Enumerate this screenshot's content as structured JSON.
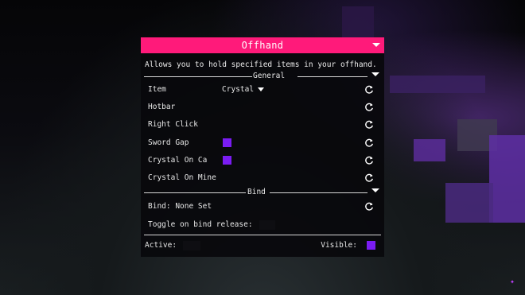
{
  "module": {
    "title": "Offhand",
    "description": "Allows you to hold specified items in your offhand."
  },
  "general": {
    "label": "General",
    "item": {
      "label": "Item",
      "value": "Crystal"
    },
    "hotbar": {
      "label": "Hotbar",
      "checked": false
    },
    "right_click": {
      "label": "Right Click",
      "checked": false
    },
    "sword_gap": {
      "label": "Sword Gap",
      "checked": true
    },
    "crystal_on_ca": {
      "label": "Crystal On Ca",
      "checked": true
    },
    "crystal_on_mine": {
      "label": "Crystal On Mine",
      "checked": false
    }
  },
  "bind": {
    "label": "Bind",
    "bind_text": "Bind: None Set",
    "toggle_label": "Toggle on bind release:",
    "toggle_checked": false
  },
  "footer": {
    "active_label": "Active:",
    "active_checked": false,
    "visible_label": "Visible:",
    "visible_checked": true
  },
  "colors": {
    "accent_header": "#ff1a7a",
    "checkbox": "#7a1cf2"
  },
  "icons": {
    "reset": "reset-icon",
    "collapse": "chevron-down-icon"
  }
}
